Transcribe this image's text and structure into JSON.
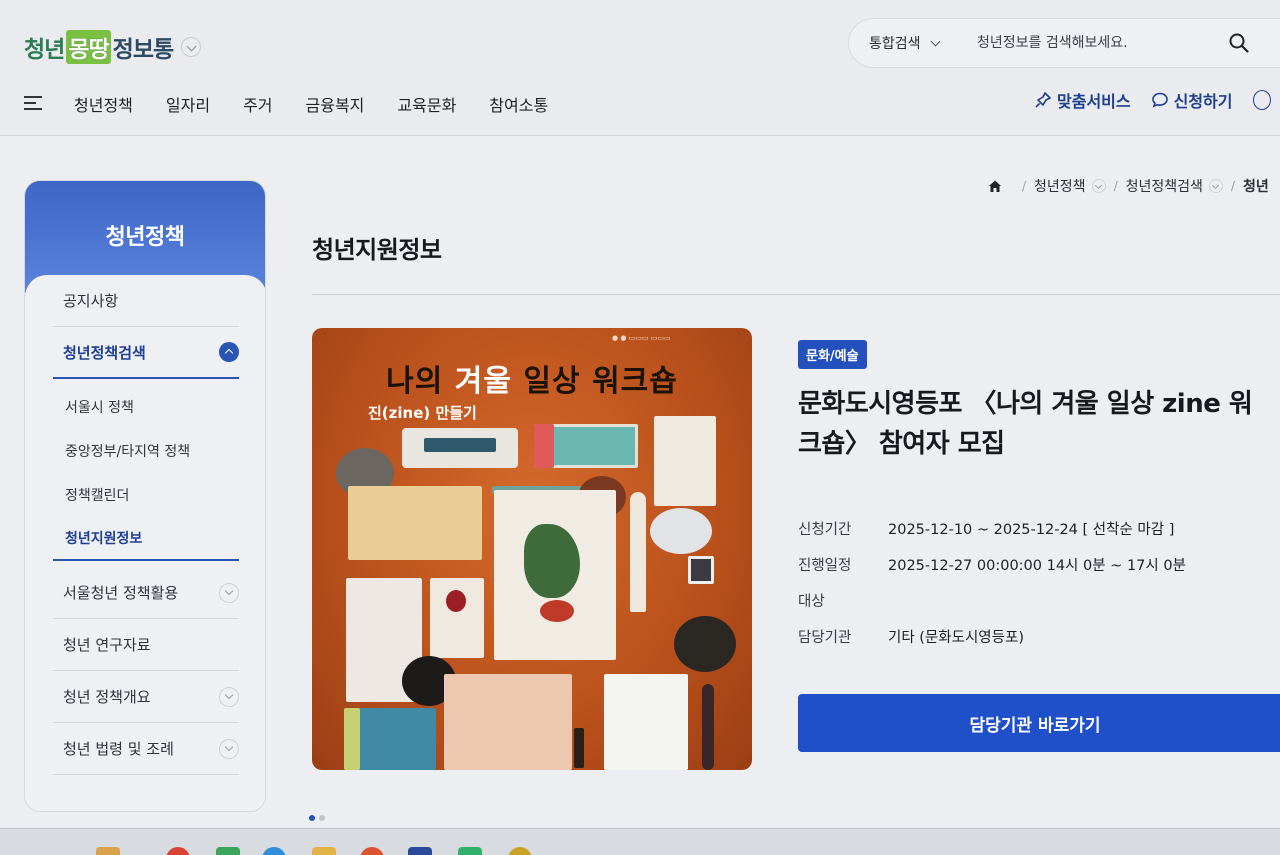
{
  "header": {
    "logo": {
      "part1": "청년",
      "part2": "몽땅",
      "part3": "정보통"
    },
    "search": {
      "scope": "통합검색",
      "placeholder": "청년정보를 검색해보세요."
    }
  },
  "nav": {
    "items": [
      "청년정책",
      "일자리",
      "주거",
      "금융복지",
      "교육문화",
      "참여소통"
    ],
    "custom_service": "맞춤서비스",
    "apply": "신청하기"
  },
  "sidebar": {
    "title": "청년정책",
    "menu": [
      {
        "label": "공지사항"
      },
      {
        "label": "청년정책검색",
        "expanded": true
      },
      {
        "label": "서울청년 정책활용"
      },
      {
        "label": "청년 연구자료"
      },
      {
        "label": "청년 정책개요"
      },
      {
        "label": "청년 법령 및 조례"
      }
    ],
    "submenu": [
      "서울시 정책",
      "중앙정부/타지역 정책",
      "정책캘린더",
      "청년지원정보"
    ]
  },
  "breadcrumb": {
    "level1": "청년정책",
    "level2": "청년정책검색",
    "level3": "청년"
  },
  "main": {
    "page_title": "청년지원정보",
    "poster": {
      "title_a": "나의 ",
      "title_b": "겨울",
      "title_c": " 일상 워크숍",
      "subtitle": "진(zine) 만들기"
    },
    "category_badge": "문화/예술",
    "title": "문화도시영등포 〈나의 겨울 일상 zine 워크숍〉 참여자 모집",
    "info": [
      {
        "key": "신청기간",
        "value": "2025-12-10 ~ 2025-12-24 [ 선착순 마감 ]"
      },
      {
        "key": "진행일정",
        "value": "2025-12-27 00:00:00 14시 0분 ~ 17시 0분"
      },
      {
        "key": "대상",
        "value": ""
      },
      {
        "key": "담당기관",
        "value": "기타 (문화도시영등포)"
      }
    ],
    "cta": "담당기관 바로가기"
  },
  "colors": {
    "accent": "#1f4fc9",
    "sidebar_head": "#4a73d4",
    "brand_green": "#2a7d4f"
  }
}
